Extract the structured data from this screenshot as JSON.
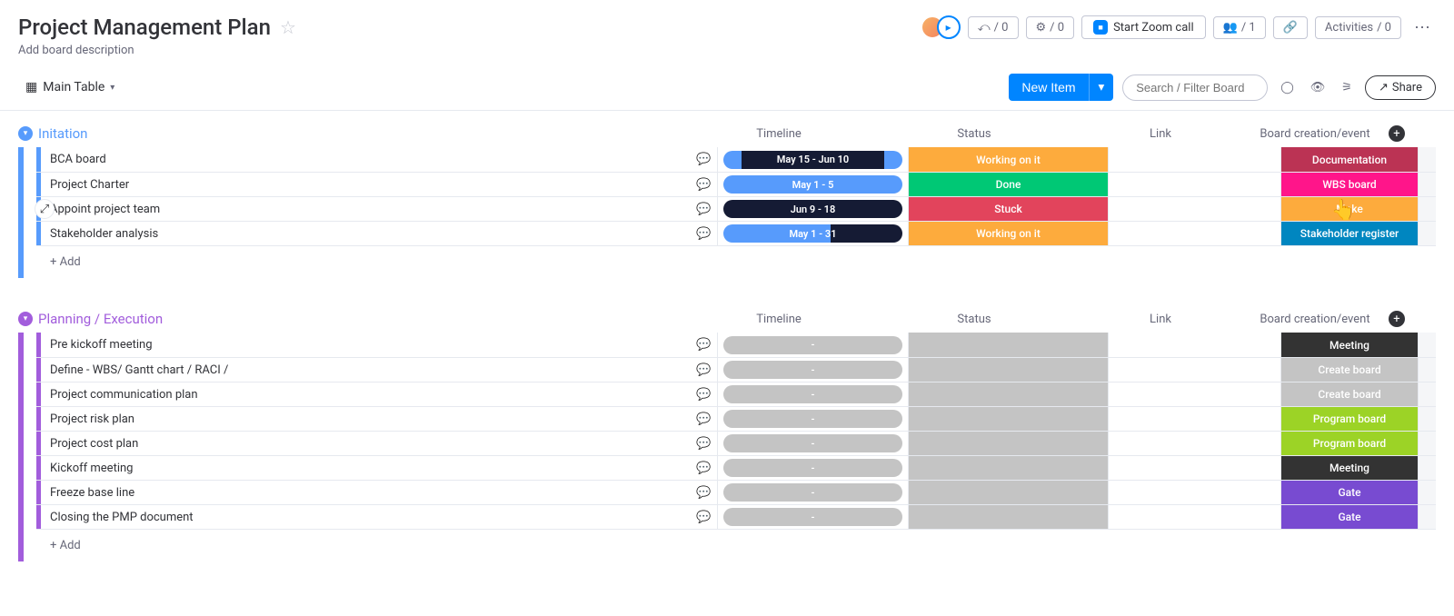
{
  "header": {
    "title": "Project Management Plan",
    "description": "Add board description",
    "llama_count": "/ 0",
    "robot_count": "/ 0",
    "zoom_label": "Start Zoom call",
    "people_count": "/ 1",
    "activities_label": "Activities",
    "activities_count": "/ 0"
  },
  "toolbar": {
    "view_name": "Main Table",
    "new_item_label": "New Item",
    "search_placeholder": "Search / Filter Board",
    "share_label": "Share"
  },
  "columns": {
    "timeline": "Timeline",
    "status": "Status",
    "link": "Link",
    "event": "Board creation/event"
  },
  "add_label": "+ Add",
  "groups": [
    {
      "name": "Initation",
      "color": "#579bfc",
      "rows": [
        {
          "name": "BCA board",
          "timeline": {
            "text": "May 15 - Jun 10",
            "segments": [
              [
                "#579bfc",
                10
              ],
              [
                "#151b34",
                80
              ],
              [
                "#579bfc",
                10
              ]
            ]
          },
          "status": {
            "text": "Working on it",
            "color": "#fdab3d"
          },
          "event": {
            "text": "Documentation",
            "color": "#bb3354"
          }
        },
        {
          "name": "Project Charter",
          "timeline": {
            "text": "May 1 - 5",
            "segments": [
              [
                "#579bfc",
                100
              ]
            ]
          },
          "status": {
            "text": "Done",
            "color": "#00c875"
          },
          "event": {
            "text": "WBS board",
            "color": "#ff158a"
          }
        },
        {
          "name": "Appoint project team",
          "timeline": {
            "text": "Jun 9 - 18",
            "segments": [
              [
                "#151b34",
                100
              ]
            ]
          },
          "status": {
            "text": "Stuck",
            "color": "#e2445c"
          },
          "event": {
            "text": "Make",
            "color": "#fdab3d"
          },
          "cursor": true,
          "side_expand": true
        },
        {
          "name": "Stakeholder analysis",
          "timeline": {
            "text": "May 1 - 31",
            "segments": [
              [
                "#579bfc",
                60
              ],
              [
                "#151b34",
                40
              ]
            ]
          },
          "status": {
            "text": "Working on it",
            "color": "#fdab3d"
          },
          "event": {
            "text": "Stakeholder register",
            "color": "#0086c0"
          }
        }
      ]
    },
    {
      "name": "Planning / Execution",
      "color": "#a25ddc",
      "rows": [
        {
          "name": "Pre kickoff meeting",
          "timeline": {
            "text": "-",
            "empty": true
          },
          "status": {
            "text": "",
            "color": "#c4c4c4"
          },
          "event": {
            "text": "Meeting",
            "color": "#333333"
          }
        },
        {
          "name": "Define - WBS/ Gantt chart / RACI /",
          "timeline": {
            "text": "-",
            "empty": true
          },
          "status": {
            "text": "",
            "color": "#c4c4c4"
          },
          "event": {
            "text": "Create board",
            "color": "#c4c4c4"
          }
        },
        {
          "name": "Project communication plan",
          "timeline": {
            "text": "-",
            "empty": true
          },
          "status": {
            "text": "",
            "color": "#c4c4c4"
          },
          "event": {
            "text": "Create board",
            "color": "#c4c4c4"
          }
        },
        {
          "name": "Project risk plan",
          "timeline": {
            "text": "-",
            "empty": true
          },
          "status": {
            "text": "",
            "color": "#c4c4c4"
          },
          "event": {
            "text": "Program board",
            "color": "#9cd326"
          }
        },
        {
          "name": "Project cost plan",
          "timeline": {
            "text": "-",
            "empty": true
          },
          "status": {
            "text": "",
            "color": "#c4c4c4"
          },
          "event": {
            "text": "Program board",
            "color": "#9cd326"
          }
        },
        {
          "name": "Kickoff meeting",
          "timeline": {
            "text": "-",
            "empty": true
          },
          "status": {
            "text": "",
            "color": "#c4c4c4"
          },
          "event": {
            "text": "Meeting",
            "color": "#333333"
          }
        },
        {
          "name": "Freeze base line",
          "timeline": {
            "text": "-",
            "empty": true
          },
          "status": {
            "text": "",
            "color": "#c4c4c4"
          },
          "event": {
            "text": "Gate",
            "color": "#784bd1"
          }
        },
        {
          "name": "Closing the PMP document",
          "timeline": {
            "text": "-",
            "empty": true
          },
          "status": {
            "text": "",
            "color": "#c4c4c4"
          },
          "event": {
            "text": "Gate",
            "color": "#784bd1"
          }
        }
      ]
    }
  ]
}
